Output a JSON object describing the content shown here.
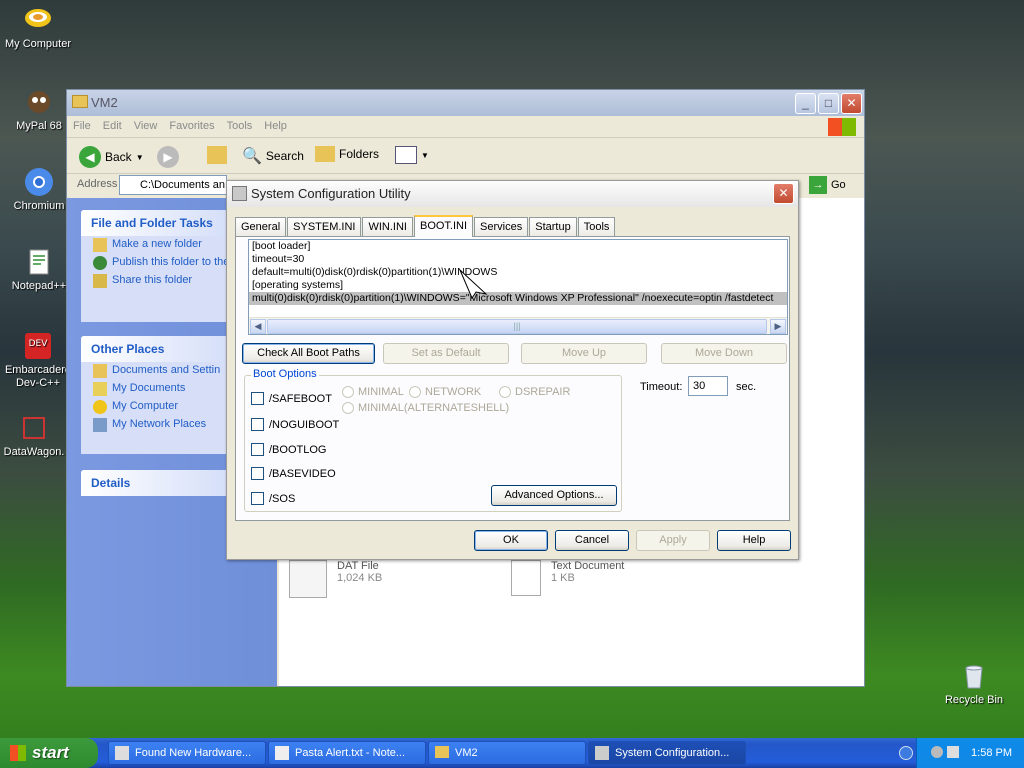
{
  "desktop": {
    "icons": [
      "My Computer",
      "MyPal 68",
      "Chromium",
      "Notepad++",
      "Embarcadero Dev-C++",
      "DataWagon.",
      "Recycle Bin"
    ]
  },
  "explorer": {
    "title": "VM2",
    "menu": [
      "File",
      "Edit",
      "View",
      "Favorites",
      "Tools",
      "Help"
    ],
    "toolbar": {
      "back": "Back",
      "search": "Search",
      "folders": "Folders"
    },
    "address_label": "Address",
    "address_value": "C:\\Documents an",
    "go": "Go",
    "tasks": {
      "title": "File and Folder Tasks",
      "items": [
        "Make a new folder",
        "Publish this folder to the Web",
        "Share this folder"
      ]
    },
    "other": {
      "title": "Other Places",
      "items": [
        "Documents and Settin",
        "My Documents",
        "My Computer",
        "My Network Places"
      ]
    },
    "details": {
      "title": "Details"
    },
    "files": [
      {
        "type": "DAT File",
        "size": "1,024 KB"
      },
      {
        "type": "Text Document",
        "size": "1 KB"
      }
    ]
  },
  "dialog": {
    "title": "System Configuration Utility",
    "tabs": [
      "General",
      "SYSTEM.INI",
      "WIN.INI",
      "BOOT.INI",
      "Services",
      "Startup",
      "Tools"
    ],
    "lines": [
      "[boot loader]",
      "timeout=30",
      "default=multi(0)disk(0)rdisk(0)partition(1)\\WINDOWS",
      "[operating systems]",
      "multi(0)disk(0)rdisk(0)partition(1)\\WINDOWS=\"Microsoft Windows XP Professional\" /noexecute=optin /fastdetect"
    ],
    "buttons": {
      "check": "Check All Boot Paths",
      "default": "Set as Default",
      "up": "Move Up",
      "down": "Move Down",
      "advanced": "Advanced Options...",
      "ok": "OK",
      "cancel": "Cancel",
      "apply": "Apply",
      "help": "Help"
    },
    "boot_options_label": "Boot Options",
    "checks": [
      "/SAFEBOOT",
      "/NOGUIBOOT",
      "/BOOTLOG",
      "/BASEVIDEO",
      "/SOS"
    ],
    "radios": [
      "MINIMAL",
      "NETWORK",
      "DSREPAIR",
      "MINIMAL(ALTERNATESHELL)"
    ],
    "timeout_label": "Timeout:",
    "timeout_value": "30",
    "timeout_unit": "sec."
  },
  "taskbar": {
    "start": "start",
    "items": [
      "Found New Hardware...",
      "Pasta Alert.txt - Note...",
      "VM2",
      "System Configuration..."
    ],
    "time": "1:58 PM"
  }
}
